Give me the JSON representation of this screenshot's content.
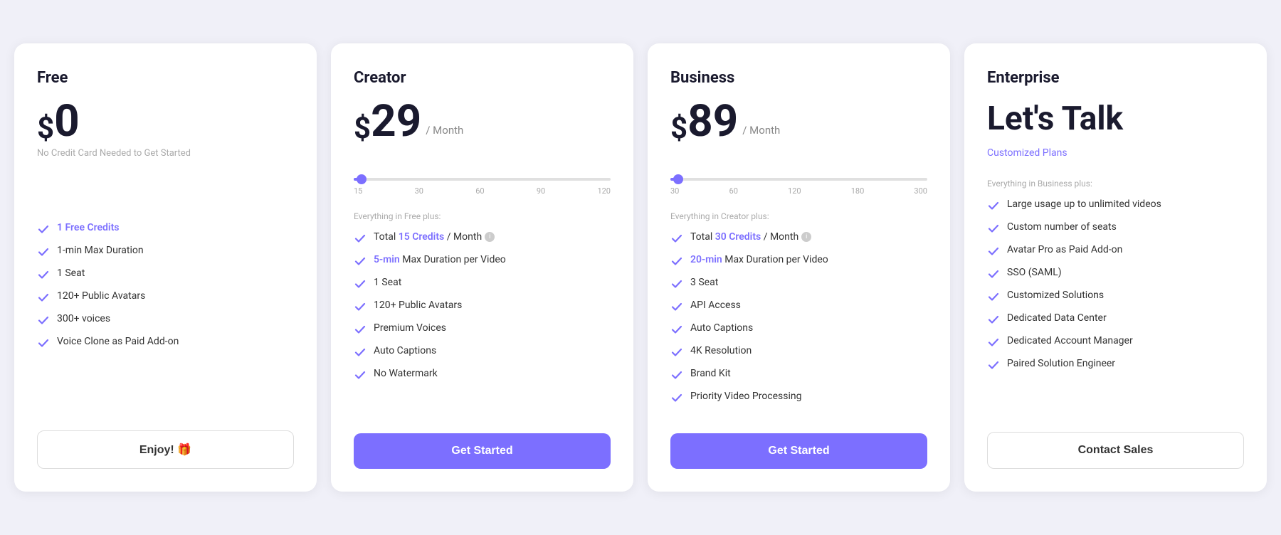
{
  "plans": [
    {
      "id": "free",
      "title": "Free",
      "price_symbol": "$",
      "price_amount": "0",
      "price_period": null,
      "price_note": "No Credit Card Needed to Get Started",
      "has_slider": false,
      "section_label": null,
      "features": [
        {
          "text": "1 Free Credits",
          "highlight": "1 Free Credits"
        },
        {
          "text": "1-min Max Duration",
          "highlight": null
        },
        {
          "text": "1 Seat",
          "highlight": null
        },
        {
          "text": "120+ Public Avatars",
          "highlight": null
        },
        {
          "text": "300+ voices",
          "highlight": null
        },
        {
          "text": "Voice Clone as Paid Add-on",
          "highlight": null
        }
      ],
      "cta_label": "Enjoy! 🎁",
      "cta_type": "outline"
    },
    {
      "id": "creator",
      "title": "Creator",
      "price_symbol": "$",
      "price_amount": "29",
      "price_period": "/ Month",
      "price_note": "",
      "has_slider": true,
      "slider_fill_pct": 3,
      "slider_thumb_pct": 3,
      "slider_labels": [
        "15",
        "30",
        "60",
        "90",
        "120"
      ],
      "section_label": "Everything in Free plus:",
      "features": [
        {
          "text": "Total 15 Credits / Month",
          "highlight": "15 Credits",
          "info": true
        },
        {
          "text": "5-min Max Duration per Video",
          "highlight": "5-min"
        },
        {
          "text": "1 Seat",
          "highlight": null
        },
        {
          "text": "120+ Public Avatars",
          "highlight": null
        },
        {
          "text": "Premium Voices",
          "highlight": null
        },
        {
          "text": "Auto Captions",
          "highlight": null
        },
        {
          "text": "No Watermark",
          "highlight": null
        }
      ],
      "cta_label": "Get Started",
      "cta_type": "filled"
    },
    {
      "id": "business",
      "title": "Business",
      "price_symbol": "$",
      "price_amount": "89",
      "price_period": "/ Month",
      "price_note": "",
      "has_slider": true,
      "slider_fill_pct": 3,
      "slider_thumb_pct": 3,
      "slider_labels": [
        "30",
        "60",
        "120",
        "180",
        "300"
      ],
      "section_label": "Everything in Creator plus:",
      "features": [
        {
          "text": "Total 30 Credits / Month",
          "highlight": "30 Credits",
          "info": true
        },
        {
          "text": "20-min Max Duration per Video",
          "highlight": "20-min"
        },
        {
          "text": "3 Seat",
          "highlight": null
        },
        {
          "text": "API Access",
          "highlight": null
        },
        {
          "text": "Auto Captions",
          "highlight": null
        },
        {
          "text": "4K Resolution",
          "highlight": null
        },
        {
          "text": "Brand Kit",
          "highlight": null
        },
        {
          "text": "Priority Video Processing",
          "highlight": null
        }
      ],
      "cta_label": "Get Started",
      "cta_type": "filled"
    },
    {
      "id": "enterprise",
      "title": "Enterprise",
      "enterprise_heading": "Let's Talk",
      "enterprise_subtitle": "Customized Plans",
      "has_slider": false,
      "section_label": "Everything in Business plus:",
      "features": [
        {
          "text": "Large usage up to unlimited videos",
          "highlight": null
        },
        {
          "text": "Custom number of seats",
          "highlight": null
        },
        {
          "text": "Avatar Pro as Paid Add-on",
          "highlight": null
        },
        {
          "text": "SSO (SAML)",
          "highlight": null
        },
        {
          "text": "Customized Solutions",
          "highlight": null
        },
        {
          "text": "Dedicated Data Center",
          "highlight": null
        },
        {
          "text": "Dedicated Account Manager",
          "highlight": null
        },
        {
          "text": "Paired Solution Engineer",
          "highlight": null
        }
      ],
      "cta_label": "Contact Sales",
      "cta_type": "outline"
    }
  ],
  "accent_color": "#7c6fff",
  "check_color": "#7c6fff"
}
